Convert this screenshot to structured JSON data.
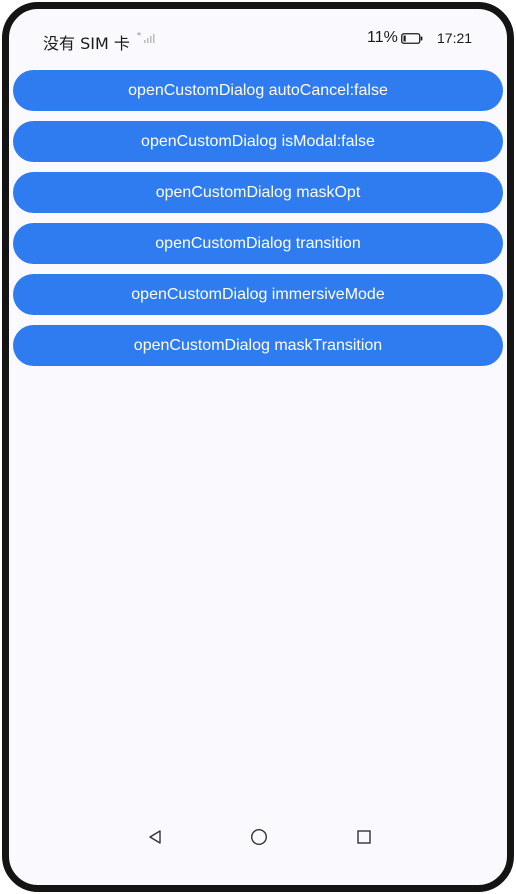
{
  "status_bar": {
    "carrier": "没有 SIM 卡",
    "battery_percent": "11%",
    "time": "17:21"
  },
  "buttons": [
    {
      "label": "openCustomDialog autoCancel:false"
    },
    {
      "label": "openCustomDialog isModal:false"
    },
    {
      "label": "openCustomDialog maskOpt"
    },
    {
      "label": "openCustomDialog transition"
    },
    {
      "label": "openCustomDialog immersiveMode"
    },
    {
      "label": "openCustomDialog maskTransition"
    }
  ],
  "nav_bar": {
    "icons": [
      "back-icon",
      "home-icon",
      "recent-apps-icon"
    ]
  },
  "colors": {
    "accent": "#2f7bf0",
    "background": "#fafafe",
    "frame": "#141414"
  }
}
